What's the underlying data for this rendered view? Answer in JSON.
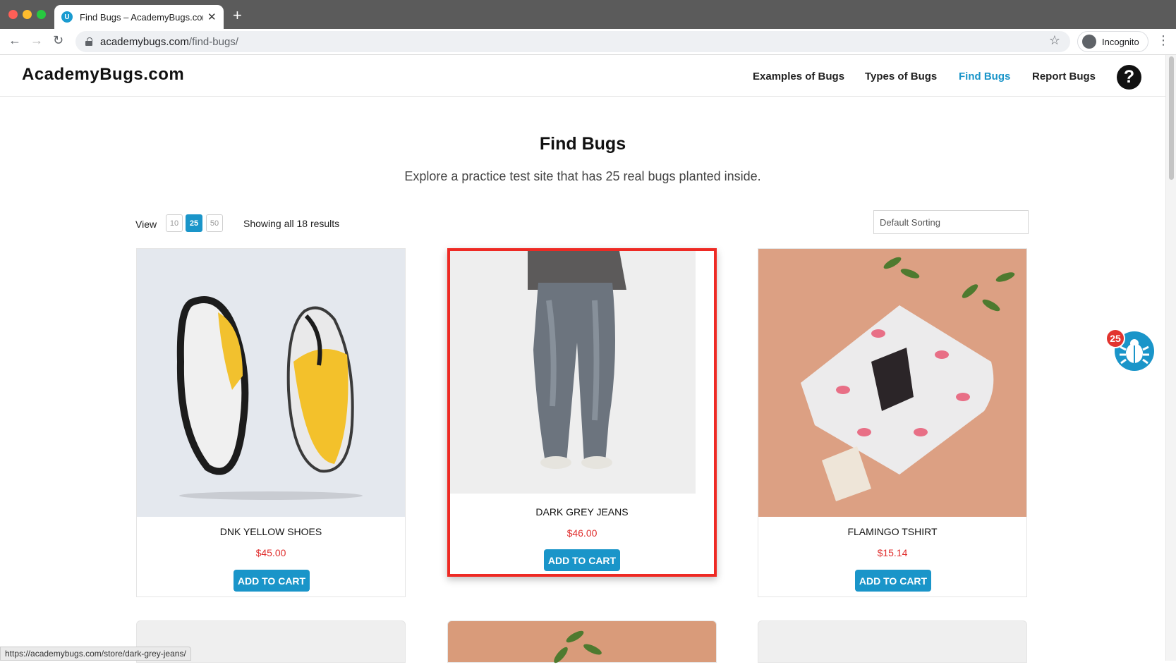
{
  "browser": {
    "tab_title": "Find Bugs – AcademyBugs.com",
    "url_host": "academybugs.com",
    "url_path": "/find-bugs/",
    "profile_label": "Incognito",
    "favicon_letter": "U"
  },
  "header": {
    "logo": "AcademyBugs.com",
    "nav": [
      {
        "label": "Examples of Bugs",
        "active": false
      },
      {
        "label": "Types of Bugs",
        "active": false
      },
      {
        "label": "Find Bugs",
        "active": true
      },
      {
        "label": "Report Bugs",
        "active": false
      }
    ],
    "help": "?"
  },
  "main": {
    "title": "Find Bugs",
    "subtitle": "Explore a practice test site that has 25 real bugs planted inside.",
    "view_label": "View",
    "view_options": [
      "10",
      "25",
      "50"
    ],
    "view_selected": "25",
    "results_text": "Showing all 18 results",
    "sorting": "Default Sorting"
  },
  "products": [
    {
      "name": "DNK Yellow Shoes",
      "price": "$45.00",
      "button": "ADD TO CART"
    },
    {
      "name": "Dark Grey Jeans",
      "price": "$46.00",
      "button": "ADD TO CART"
    },
    {
      "name": "Flamingo Tshirt",
      "price": "$15.14",
      "button": "ADD TO CART"
    }
  ],
  "bug_widget": {
    "count": "25"
  },
  "status_bar": "https://academybugs.com/store/dark-grey-jeans/",
  "colors": {
    "accent": "#1a95c9",
    "price": "#e0302f",
    "highlight": "#ee2a24"
  }
}
